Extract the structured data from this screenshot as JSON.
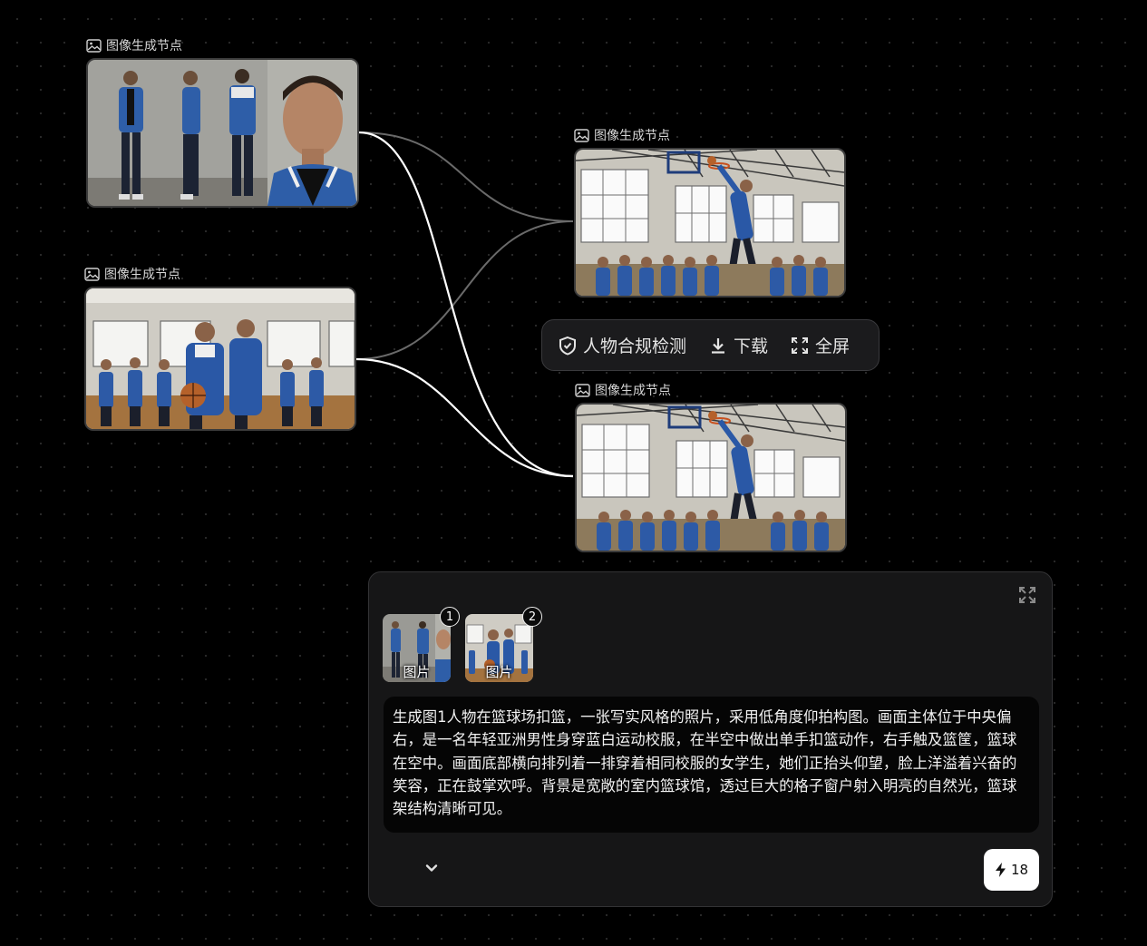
{
  "nodes": [
    {
      "label": "图像生成节点",
      "image": "character-turnaround-sheet"
    },
    {
      "label": "图像生成节点",
      "image": "gym-students-scene"
    },
    {
      "label": "图像生成节点",
      "image": "slam-dunk-gym-scene"
    },
    {
      "label": "图像生成节点",
      "image": "slam-dunk-gym-scene"
    }
  ],
  "toolbar": {
    "compliance_label": "人物合规检测",
    "download_label": "下载",
    "fullscreen_label": "全屏",
    "compliance_icon": "shield-check-icon",
    "download_icon": "download-icon",
    "fullscreen_icon": "fullscreen-icon"
  },
  "panel": {
    "thumbnails": [
      {
        "caption": "图片",
        "badge": "1"
      },
      {
        "caption": "图片",
        "badge": "2"
      }
    ],
    "prompt": "生成图1人物在篮球场扣篮，一张写实风格的照片，采用低角度仰拍构图。画面主体位于中央偏右，是一名年轻亚洲男性身穿蓝白运动校服，在半空中做出单手扣篮动作，右手触及篮筐，篮球在空中。画面底部横向排列着一排穿着相同校服的女学生，她们正抬头仰望，脸上洋溢着兴奋的笑容，正在鼓掌欢呼。背景是宽敞的室内篮球馆，透过巨大的格子窗户射入明亮的自然光，篮球架结构清晰可见。",
    "run_count": "18",
    "run_icon": "lightning-icon",
    "collapse_icon": "chevron-down-icon",
    "expand_icon": "expand-icon"
  }
}
